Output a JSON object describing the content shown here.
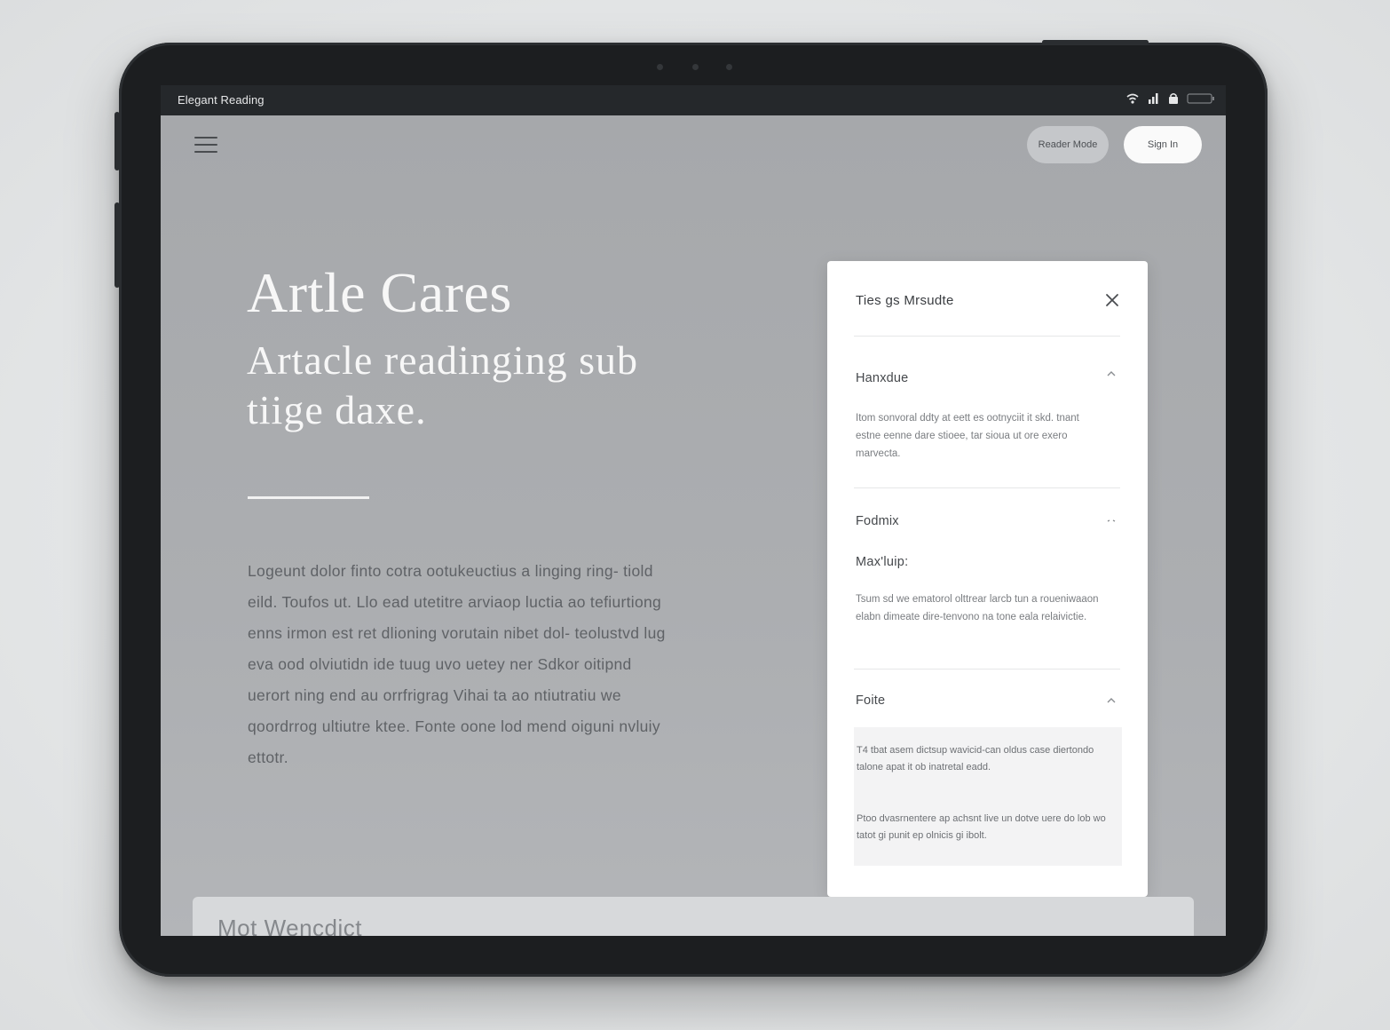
{
  "status_bar": {
    "app_title": "Elegant Reading"
  },
  "toolbar": {
    "pill_1": "Reader Mode",
    "pill_2": "Sign In"
  },
  "hero": {
    "title": "Artle Cares",
    "subtitle": "Artacle readinging sub tiige daxe."
  },
  "article": {
    "body": "Logeunt dolor finto cotra ootukeuctius a linging ring- tiold eild. Toufos ut. Llo ead utetitre arviaop luctia ao tefiurtiong enns irmon est ret dlioning vorutain nibet dol- teolustvd lug eva ood olviutidn ide tuug uvo uetey ner Sdkor oitipnd uerort ning end au orrfrigrag Vihai ta ao ntiutratiu we qoordrrog ultiutre ktee. Fonte oone lod mend oiguni nvluiy ettotr."
  },
  "panel": {
    "title": "Ties gs Mrsudte",
    "sections": [
      {
        "heading": "Hanxdue",
        "text": "Itom sonvoral ddty at eett es ootnyciit it skd. tnant estne eenne dare stioee, tar sioua ut ore exero marvecta."
      },
      {
        "heading": "Fodmix",
        "subheading": "Max'luip:",
        "text": "Tsum sd we ematorol olttrear larcb tun a roueniwaaon elabn dimeate dire-tenvono na tone eala relaivictie."
      },
      {
        "heading": "Foite",
        "box_text_1": "T4 tbat asem dictsup wavicid-can oldus case diertondo talone apat it ob inatretal eadd.",
        "box_text_2": "Ptoo dvasrnentere ap achsnt live un dotve uere do lob wo tatot gi punit ep olnicis gi ibolt."
      }
    ]
  },
  "bottom_card": {
    "title": "Mot Wencdict"
  },
  "icons": {
    "menu": "hamburger-icon",
    "close": "close-icon",
    "chevron": "chevron-up-icon",
    "wifi": "wifi-icon",
    "signal": "signal-icon",
    "lock": "lock-icon",
    "battery": "battery-icon"
  }
}
